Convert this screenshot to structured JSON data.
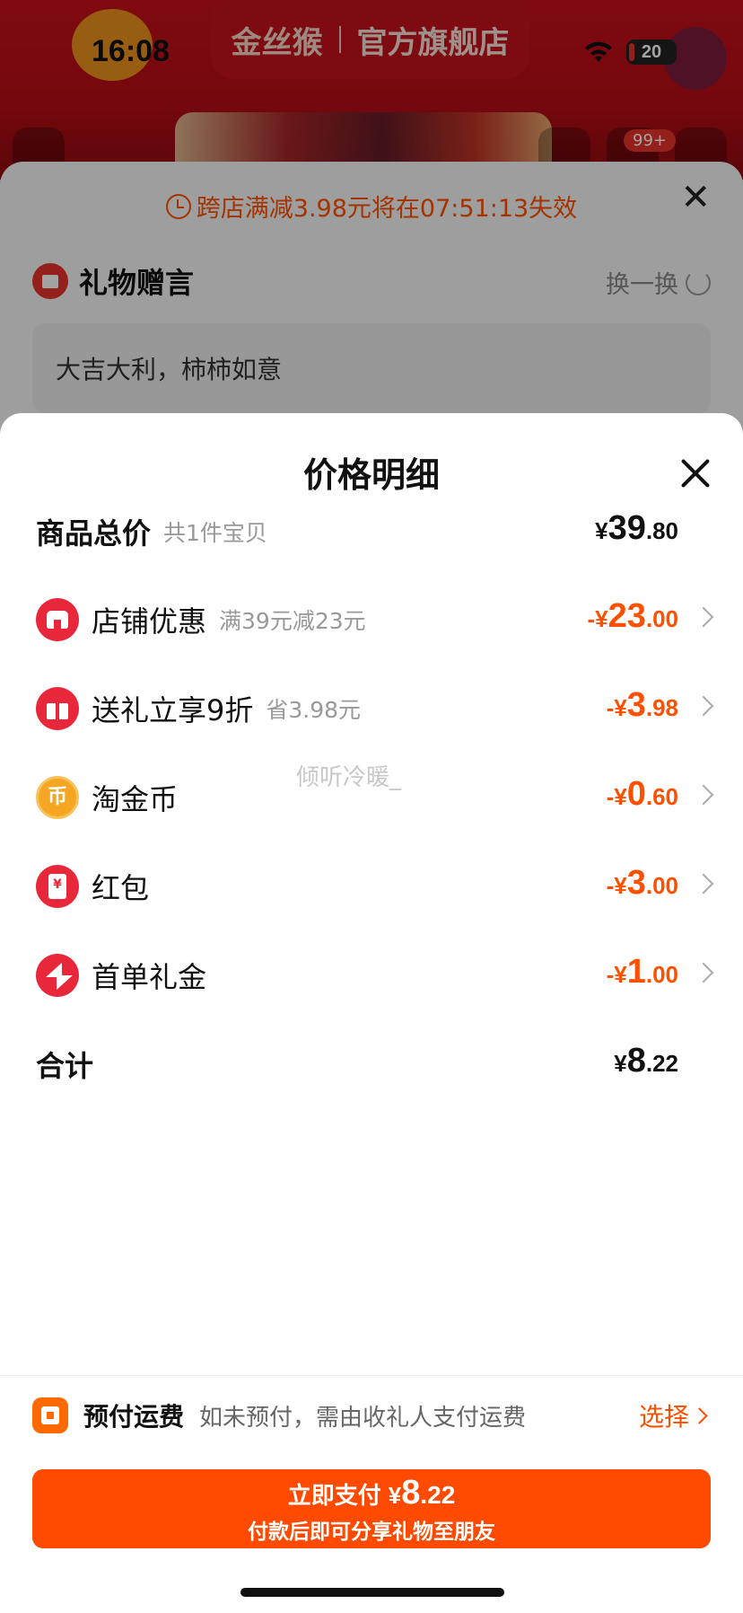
{
  "status_bar": {
    "time": "16:08",
    "battery": "20"
  },
  "store_header": {
    "logo_text": "金丝猴",
    "store_name": "官方旗舰店",
    "cart_badge": "99+"
  },
  "gift_sheet": {
    "cross_store_promo": "跨店满减3.98元将在07:51:13失效",
    "title": "礼物赠言",
    "refresh_label": "换一换",
    "message": "大吉大利，柿柿如意"
  },
  "price_detail": {
    "title": "价格明细",
    "rows": [
      {
        "label": "商品总价",
        "sub": "共1件宝贝",
        "yen": "¥",
        "int": "39",
        "dec": ".80",
        "icon": "none"
      },
      {
        "label": "店铺优惠",
        "sub": "满39元减23元",
        "yen": "-¥",
        "int": "23",
        "dec": ".00",
        "icon": "store-icon"
      },
      {
        "label": "送礼立享9折",
        "sub": "省3.98元",
        "yen": "-¥",
        "int": "3",
        "dec": ".98",
        "icon": "gift-icon"
      },
      {
        "label": "淘金币",
        "sub": "",
        "yen": "-¥",
        "int": "0",
        "dec": ".60",
        "icon": "coin-icon"
      },
      {
        "label": "红包",
        "sub": "",
        "yen": "-¥",
        "int": "3",
        "dec": ".00",
        "icon": "red-packet-icon"
      },
      {
        "label": "首单礼金",
        "sub": "",
        "yen": "-¥",
        "int": "1",
        "dec": ".00",
        "icon": "lightning-icon"
      },
      {
        "label": "合计",
        "sub": "",
        "yen": "¥",
        "int": "8",
        "dec": ".22",
        "icon": "none"
      }
    ],
    "watermark": "倾听冷暖_"
  },
  "shipping": {
    "title": "预付运费",
    "description": "如未预付，需由收礼人支付运费",
    "action": "选择"
  },
  "pay_button": {
    "label": "立即支付",
    "yen": "¥",
    "int": "8",
    "dec": ".22",
    "subtitle": "付款后即可分享礼物至朋友"
  },
  "colors": {
    "accent": "#ff5000",
    "button": "#ff4a00",
    "icon_red": "#e8283a"
  }
}
